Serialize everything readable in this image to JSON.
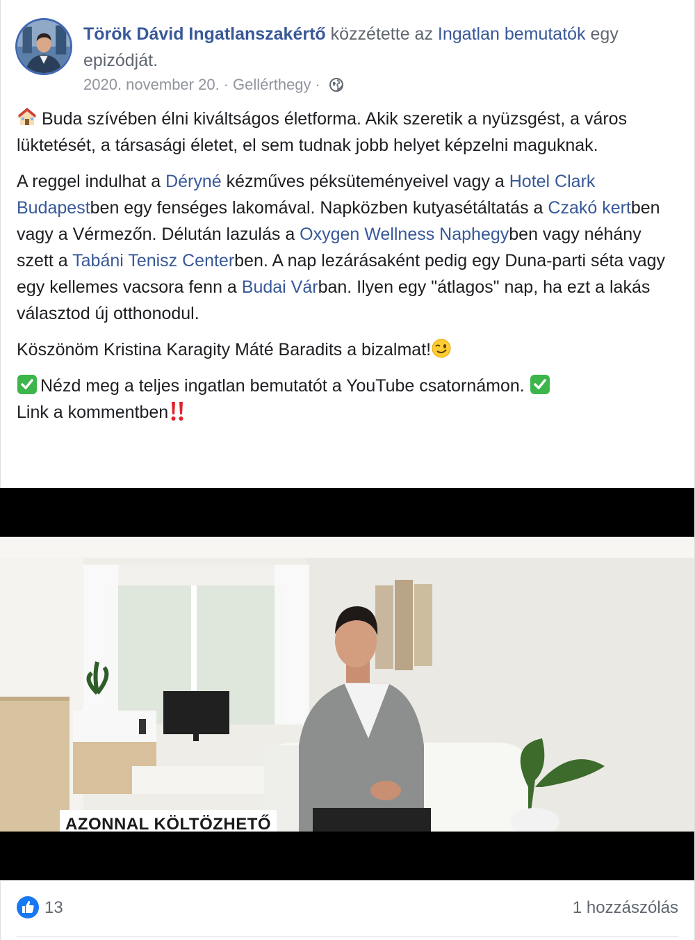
{
  "post": {
    "author": "Török Dávid Ingatlanszakértő",
    "action_text": " közzétette az ",
    "series_link": "Ingatlan bemutatók",
    "action_suffix": " egy epizódját.",
    "date": "2020. november 20.",
    "separator": "·",
    "location": "Gellérthegy",
    "privacy_icon": "globe-icon"
  },
  "body": {
    "p1": "Buda szívében élni kiváltságos életforma. Akik szeretik a nyüzsgést, a város lüktetését, a társasági életet, el sem tudnak jobb helyet képzelni maguknak.",
    "p2": {
      "t1": "A reggel indulhat a ",
      "l1": "Déryné",
      "t2": " kézműves péksüteményeivel vagy a ",
      "l2": "Hotel Clark Budapest",
      "t3": "ben egy fenséges lakomával. Napközben kutyasétáltatás a ",
      "l3": "Czakó kert",
      "t4": "ben vagy a Vérmezőn. Délután lazulás a ",
      "l4": "Oxygen Wellness Naphegy",
      "t5": "ben vagy néhány szett a ",
      "l5": "Tabáni Tenisz Center",
      "t6": "ben. A nap lezárásaként pedig egy Duna-parti séta vagy egy kellemes vacsora fenn a ",
      "l6": "Budai Vár",
      "t7": "ban. Ilyen egy \"átlagos\" nap, ha ezt a lakás választod új otthonodul."
    },
    "p3": "Köszönöm Kristina Karagity Máté Baradits a bizalmat!",
    "p4a": "Nézd meg a teljes ingatlan bemutatót a YouTube csatornámon.",
    "p4b": "Link a kommentben"
  },
  "video": {
    "caption": "AZONNAL KÖLTÖZHETŐ"
  },
  "footer": {
    "likes": "13",
    "comments": "1 hozzászólás"
  },
  "colors": {
    "link": "#385898",
    "like_blue": "#1877f2",
    "check_green": "#3cb54a"
  }
}
